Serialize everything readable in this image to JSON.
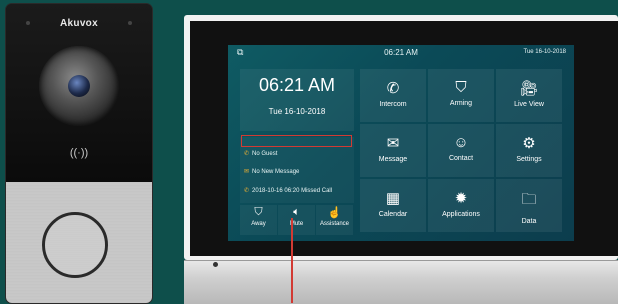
{
  "door_station": {
    "brand": "Akuvox",
    "nfc_symbol": "((·))"
  },
  "monitor": {
    "status": {
      "screen_icon": "⧉",
      "time": "06:21 AM",
      "date": "Tue   16-10-2018"
    },
    "clock": {
      "time": "06:21 AM",
      "date": "Tue  16-10-2018"
    },
    "notifications": [
      {
        "icon": "✆",
        "text": "No Guest"
      },
      {
        "icon": "✉",
        "text": "No New Message"
      },
      {
        "icon": "✆",
        "text": "2018-10-16 06:20 Missed Call"
      }
    ],
    "quick_actions": [
      {
        "icon": "⛉",
        "label": "Away"
      },
      {
        "icon": "🔈︎",
        "label": "Mute"
      },
      {
        "icon": "☝",
        "label": "Assistance"
      }
    ],
    "tiles": [
      {
        "icon": "✆",
        "label": "Intercom"
      },
      {
        "icon": "⛉",
        "label": "Arming"
      },
      {
        "icon": "🎥︎",
        "label": "Live View"
      },
      {
        "icon": "✉",
        "label": "Message"
      },
      {
        "icon": "☺",
        "label": "Contact"
      },
      {
        "icon": "⚙",
        "label": "Settings"
      },
      {
        "icon": "▦",
        "label": "Calendar"
      },
      {
        "icon": "✹",
        "label": "Applications"
      },
      {
        "icon": "🗀︎",
        "label": "Data"
      }
    ]
  },
  "colors": {
    "background": "#0e4f4b",
    "screen": "#0c4c58",
    "highlight_red": "#d23a33",
    "icon_orange": "#f2b233"
  }
}
